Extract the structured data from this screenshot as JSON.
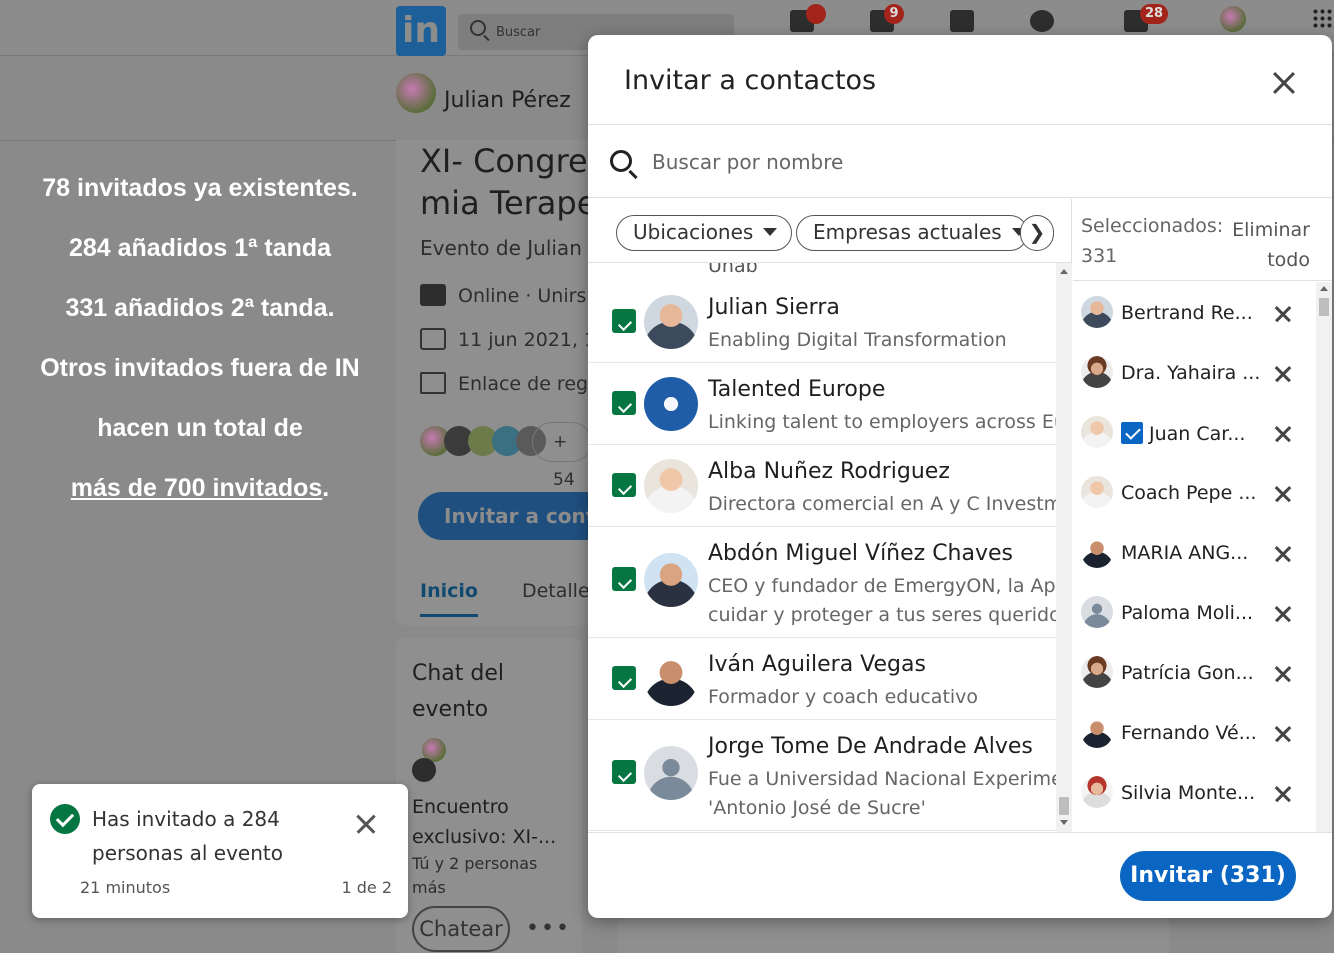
{
  "nav": {
    "search_placeholder": "Buscar",
    "messages_badge": "9",
    "notifications_badge": "28",
    "logo_text": "in"
  },
  "host": {
    "name": "Julian Pérez"
  },
  "promo": {
    "line1": "78 invitados ya existentes.",
    "line2": "284 añadidos 1ª tanda",
    "line3": "331 añadidos 2ª tanda.",
    "line4": "Otros invitados fuera de IN",
    "line5": "hacen un total de",
    "line6_underlined": "más de 700 invitados",
    "line6_end": "."
  },
  "event": {
    "title_line1": "XI- Congre",
    "title_line2": "mia Terape",
    "organizer": "Evento de Julian",
    "mode": "Online · Unirs",
    "date": "11 jun 2021, 1",
    "link": "Enlace de reg",
    "attendees_more": "+ 54",
    "invite_button": "Invitar a cont",
    "tabs": {
      "home": "Inicio",
      "details": "Detalles"
    }
  },
  "chat": {
    "title": "Chat del evento",
    "name": "Encuentro exclusivo: XI-...",
    "meta": "Tú y 2 personas más",
    "button": "Chatear",
    "more": "•••"
  },
  "toast": {
    "message": "Has invitado a 284 personas al evento",
    "time": "21 minutos",
    "page": "1 de 2"
  },
  "modal": {
    "title": "Invitar a contactos",
    "search_placeholder": "Buscar por nombre",
    "filters": {
      "locations": "Ubicaciones",
      "companies": "Empresas actuales",
      "next": "❯"
    },
    "cut_row": "Unab",
    "contacts": [
      {
        "name": "Julian Sierra",
        "desc1": "Enabling Digital Transformation",
        "desc2": ""
      },
      {
        "name": "Talented Europe",
        "desc1": "Linking talent to employers across Eur",
        "desc2": ""
      },
      {
        "name": "Alba Nuñez Rodriguez",
        "desc1": "Directora comercial en A y C Investme",
        "desc2": ""
      },
      {
        "name": "Abdón Miguel Víñez Chaves",
        "desc1": "CEO y fundador de EmergyON, la App",
        "desc2": "cuidar y proteger a tus seres queridos"
      },
      {
        "name": "Iván Aguilera Vegas",
        "desc1": "Formador y coach educativo",
        "desc2": ""
      },
      {
        "name": "Jorge Tome De Andrade Alves",
        "desc1": "Fue a Universidad Nacional Experimen",
        "desc2": "'Antonio José de Sucre'"
      }
    ],
    "selected": {
      "label": "Seleccionados:",
      "count": "331",
      "clear_all": "Eliminar todo",
      "items": [
        "Bertrand Re...",
        "Dra. Yahaira ...",
        "Juan Car...",
        "Coach Pepe ...",
        "MARIA ANG...",
        "Paloma Moli...",
        "Patrícia Gon...",
        "Fernando Vé...",
        "Silvia Monte..."
      ]
    },
    "invite_button": "Invitar (331)"
  }
}
